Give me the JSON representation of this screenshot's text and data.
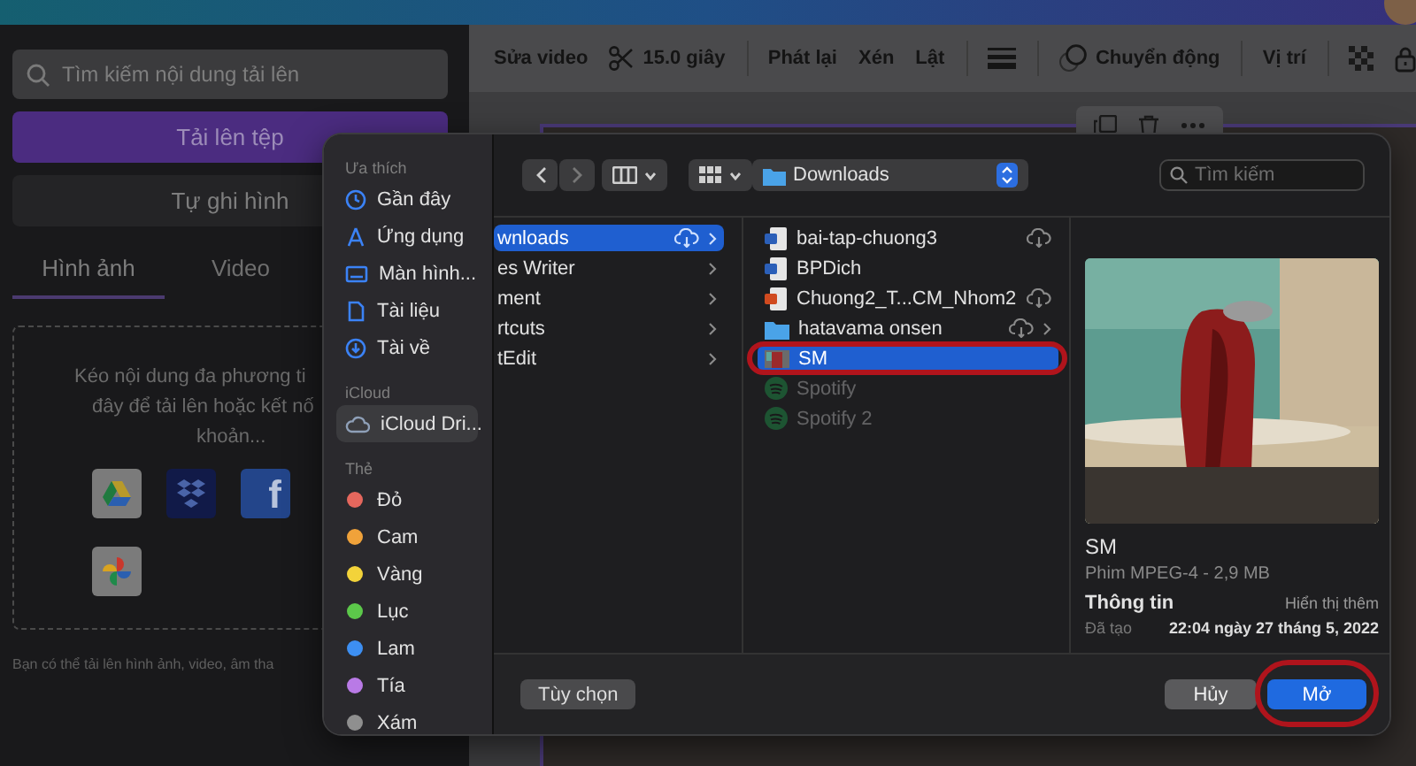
{
  "upload_panel": {
    "search": {
      "placeholder": "Tìm kiếm nội dung tải lên"
    },
    "upload_button": "Tải lên tệp",
    "record_button": "Tự ghi hình",
    "tabs": [
      {
        "label": "Hình ảnh",
        "selected": true
      },
      {
        "label": "Video",
        "selected": false
      }
    ],
    "drop_zone": {
      "lines": [
        "Kéo nội dung đa phương ti",
        "đây để tải lên hoặc kết nố",
        "khoản..."
      ],
      "sources": [
        {
          "kind": "drive"
        },
        {
          "kind": "dropbox"
        },
        {
          "kind": "facebook",
          "label": "f"
        },
        {
          "kind": "photos"
        }
      ]
    },
    "footnote": "Bạn có thể tải lên hình ảnh, video, âm tha"
  },
  "toolbar": {
    "items": [
      {
        "kind": "text",
        "label": "Sửa video"
      },
      {
        "kind": "scissors",
        "label": "15.0 giây"
      },
      {
        "kind": "text",
        "label": "Phát lại"
      },
      {
        "kind": "text",
        "label": "Xén"
      },
      {
        "kind": "text",
        "label": "Lật"
      },
      {
        "kind": "lines"
      },
      {
        "kind": "motion",
        "label": "Chuyển động"
      },
      {
        "kind": "text",
        "label": "Vị trí"
      },
      {
        "kind": "checker"
      },
      {
        "kind": "lock"
      }
    ]
  },
  "element_actions": [
    {
      "kind": "copy"
    },
    {
      "kind": "trash"
    },
    {
      "kind": "more"
    }
  ],
  "file_dialog": {
    "sidebar": [
      {
        "heading": "Ưa thích",
        "items": [
          {
            "label": "Gần đây",
            "kind": "recent",
            "selected": false
          },
          {
            "label": "Ứng dụng",
            "kind": "apps",
            "selected": false
          },
          {
            "label": "Màn hình...",
            "kind": "desktop",
            "selected": false
          },
          {
            "label": "Tài liệu",
            "kind": "documents",
            "selected": false
          },
          {
            "label": "Tài về",
            "kind": "downloads",
            "selected": false
          }
        ]
      },
      {
        "heading": "iCloud",
        "items": [
          {
            "label": "iCloud Dri...",
            "kind": "cloud",
            "selected": true
          }
        ]
      },
      {
        "heading": "Thẻ",
        "items": [
          {
            "label": "Đỏ",
            "kind": "tag",
            "color": "#e5675d",
            "selected": false
          },
          {
            "label": "Cam",
            "kind": "tag",
            "color": "#f0a23a",
            "selected": false
          },
          {
            "label": "Vàng",
            "kind": "tag",
            "color": "#f3d33a",
            "selected": false
          },
          {
            "label": "Lục",
            "kind": "tag",
            "color": "#5cc84a",
            "selected": false
          },
          {
            "label": "Lam",
            "kind": "tag",
            "color": "#3d8ff2",
            "selected": false
          },
          {
            "label": "Tía",
            "kind": "tag",
            "color": "#b97ae6",
            "selected": false
          },
          {
            "label": "Xám",
            "kind": "tag",
            "color": "#8f8f8f",
            "selected": false
          }
        ]
      }
    ],
    "location": "Downloads",
    "search": {
      "placeholder": "Tìm kiếm"
    },
    "columns": [
      {
        "items": [
          {
            "name": "wnloads",
            "kind": "folder",
            "selected": true,
            "cloud": true,
            "chevron": true,
            "disabled": false,
            "circled": false
          },
          {
            "name": "es Writer",
            "kind": "folder",
            "selected": false,
            "cloud": false,
            "chevron": true,
            "disabled": false,
            "circled": false
          },
          {
            "name": "ment",
            "kind": "folder",
            "selected": false,
            "cloud": false,
            "chevron": true,
            "disabled": false,
            "circled": false
          },
          {
            "name": "rtcuts",
            "kind": "folder",
            "selected": false,
            "cloud": false,
            "chevron": true,
            "disabled": false,
            "circled": false
          },
          {
            "name": "tEdit",
            "kind": "folder",
            "selected": false,
            "cloud": false,
            "chevron": true,
            "disabled": false,
            "circled": false
          }
        ]
      },
      {
        "items": [
          {
            "name": "bai-tap-chuong3",
            "kind": "word",
            "selected": false,
            "cloud": true,
            "chevron": false,
            "disabled": false,
            "circled": false
          },
          {
            "name": "BPDich",
            "kind": "word",
            "selected": false,
            "cloud": false,
            "chevron": false,
            "disabled": false,
            "circled": false
          },
          {
            "name": "Chuong2_T...CM_Nhom2",
            "kind": "slides",
            "selected": false,
            "cloud": true,
            "chevron": false,
            "disabled": false,
            "circled": false
          },
          {
            "name": "hatavama onsen",
            "kind": "folder_icon",
            "selected": false,
            "cloud": true,
            "chevron": true,
            "disabled": false,
            "circled": false
          },
          {
            "name": "SM",
            "kind": "video",
            "selected": true,
            "cloud": false,
            "chevron": false,
            "disabled": false,
            "circled": true
          },
          {
            "name": "Spotify",
            "kind": "app",
            "selected": false,
            "cloud": false,
            "chevron": false,
            "disabled": true,
            "circled": false
          },
          {
            "name": "Spotify 2",
            "kind": "app",
            "selected": false,
            "cloud": false,
            "chevron": false,
            "disabled": true,
            "circled": false
          }
        ]
      }
    ],
    "preview": {
      "name": "SM",
      "info": "Phim MPEG-4 - 2,9 MB",
      "section": "Thông tin",
      "more": "Hiển thị thêm",
      "created_label": "Đã tạo",
      "created_value": "22:04 ngày 27 tháng 5, 2022"
    },
    "buttons": [
      {
        "label": "Tùy chọn",
        "kind": "options",
        "circled": false
      },
      {
        "label": "Hủy",
        "kind": "cancel",
        "circled": false
      },
      {
        "label": "Mở",
        "kind": "default",
        "circled": true
      }
    ]
  }
}
